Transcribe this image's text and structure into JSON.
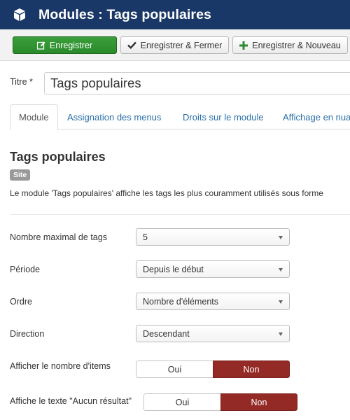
{
  "header": {
    "title": "Modules : Tags populaires",
    "icon": "cube-icon"
  },
  "toolbar": {
    "save_label": "Enregistrer",
    "save_close_label": "Enregistrer & Fermer",
    "save_new_label": "Enregistrer & Nouveau"
  },
  "title_field": {
    "label": "Titre *",
    "value": "Tags populaires"
  },
  "tabs": [
    {
      "label": "Module",
      "active": true
    },
    {
      "label": "Assignation des menus",
      "active": false
    },
    {
      "label": "Droits sur le module",
      "active": false
    },
    {
      "label": "Affichage en nuage",
      "active": false
    }
  ],
  "module": {
    "heading": "Tags populaires",
    "badge": "Site",
    "description": "Le module 'Tags populaires' affiche les tags les plus couramment utilisés sous forme"
  },
  "fields": {
    "max_tags": {
      "label": "Nombre maximal de tags",
      "value": "5"
    },
    "period": {
      "label": "Période",
      "value": "Depuis le début"
    },
    "order": {
      "label": "Ordre",
      "value": "Nombre d'éléments"
    },
    "direction": {
      "label": "Direction",
      "value": "Descendant"
    },
    "show_count": {
      "label": "Afficher le nombre d'items",
      "yes": "Oui",
      "no": "Non",
      "selected": "Non"
    },
    "no_results_text": {
      "label": "Affiche le texte \"Aucun résultat\"",
      "yes": "Oui",
      "no": "Non",
      "selected": "Non"
    }
  },
  "colors": {
    "header_bg": "#1a3867",
    "save_green": "#2e8b2e",
    "toggle_active_red": "#942a25",
    "link_blue": "#2a6fa8"
  }
}
